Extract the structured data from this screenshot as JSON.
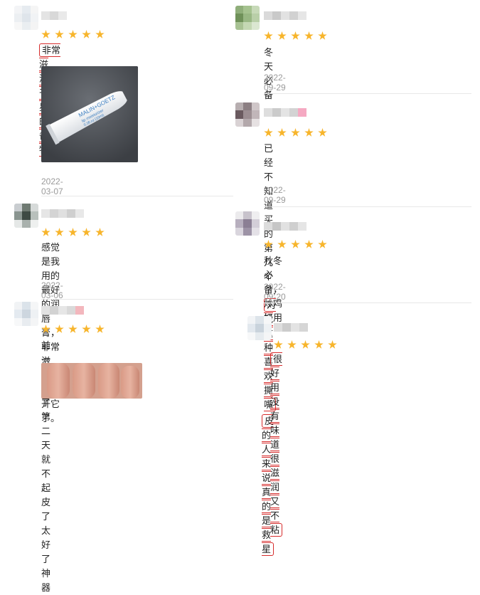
{
  "left": [
    {
      "rating": 5,
      "text": "非常滋润，干皮星人的必备好物",
      "date": "2022-03-07",
      "photo": {
        "kind": "lip-balm-tube",
        "brand": "MALIN+GOETZ",
        "sub1": "lip moisturizer",
        "sub2": "0.3fl.oz (10ml)"
      }
    },
    {
      "rating": 5,
      "text_line1": "感觉是我用的最好的润唇膏，非常滋润，离不",
      "text_line2": "开它了。",
      "date": "2022-03-06"
    },
    {
      "rating": 5,
      "text": "前一天涂了 第二天就不起皮了 太好了 神器",
      "photo": {
        "kind": "hand"
      }
    }
  ],
  "right": [
    {
      "rating": 5,
      "text": "冬天必备",
      "date": "2022-09-29"
    },
    {
      "rating": 5,
      "text_plain": "已经不知道买的第几个了,",
      "text_hl1": "对我这种喜欢撕嘴",
      "text_hl2": "皮的人来说真的是救星",
      "date": "2022-09-29"
    },
    {
      "rating": 5,
      "text": "秋冬必备，炒鸡好用",
      "date": "2022-09-20"
    },
    {
      "rating": 5,
      "text": "很好用没有味道 很滋润又不粘"
    }
  ],
  "colors": {
    "star": "#f7b52c",
    "highlight": "#d62b2b",
    "date": "#9a9a9a"
  }
}
